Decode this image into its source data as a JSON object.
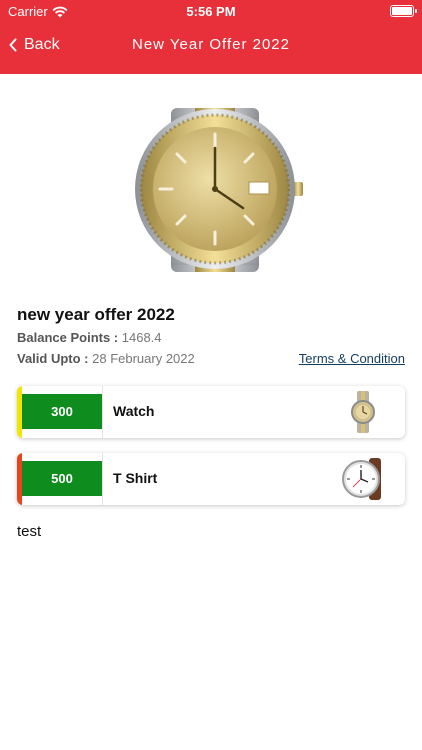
{
  "status": {
    "carrier": "Carrier",
    "time": "5:56 PM"
  },
  "nav": {
    "back_label": "Back",
    "title": "New Year Offer 2022"
  },
  "offer": {
    "title": "new year offer 2022",
    "balance_label": "Balance Points :",
    "balance_value": "1468.4",
    "valid_label": "Valid Upto :",
    "valid_value": "28 February 2022",
    "terms_label": "Terms & Condition"
  },
  "rewards": [
    {
      "points": "300",
      "name": "Watch",
      "stripe_color": "#f2e600"
    },
    {
      "points": "500",
      "name": "T Shirt",
      "stripe_color": "#e8451e"
    }
  ],
  "description": "test",
  "colors": {
    "header": "#e8303a",
    "points_bg": "#0f8c1e",
    "terms_link": "#143d5e"
  }
}
